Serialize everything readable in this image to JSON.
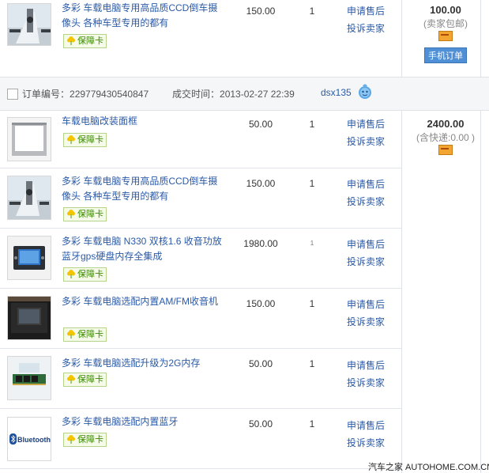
{
  "items_top": {
    "title": "多彩 车载电脑专用高品质CCD倒车摄像头 各种车型专用的都有",
    "price": "150.00",
    "qty": "1",
    "badge": "保障卡",
    "actions": [
      "申请售后",
      "投诉卖家"
    ]
  },
  "summary_top": {
    "total": "100.00",
    "shipping": "(卖家包邮)",
    "mobile_order": "手机订单"
  },
  "order": {
    "number_label": "订单编号：",
    "number": "229779430540847",
    "time_label": "成交时间：",
    "time": "2013-02-27 22:39",
    "seller": "dsx135"
  },
  "items": [
    {
      "title": "车载电脑改装面框",
      "price": "50.00",
      "qty": "1",
      "badge": "保障卡",
      "actions": [
        "申请售后",
        "投诉卖家"
      ]
    },
    {
      "title": "多彩 车载电脑专用高品质CCD倒车摄像头 各种车型专用的都有",
      "price": "150.00",
      "qty": "1",
      "badge": "保障卡",
      "actions": [
        "申请售后",
        "投诉卖家"
      ]
    },
    {
      "title": "多彩 车载电脑 N330 双核1.6 收音功放蓝牙gps硬盘内存全集成",
      "price": "1980.00",
      "qty": "1",
      "badge": "保障卡",
      "actions": [
        "申请售后",
        "投诉卖家"
      ]
    },
    {
      "title": "多彩 车载电脑选配内置AM/FM收音机",
      "price": "150.00",
      "qty": "1",
      "badge": "保障卡",
      "actions": [
        "申请售后",
        "投诉卖家"
      ]
    },
    {
      "title": "多彩 车载电脑选配升级为2G内存",
      "price": "50.00",
      "qty": "1",
      "badge": "保障卡",
      "actions": [
        "申请售后",
        "投诉卖家"
      ]
    },
    {
      "title": "多彩 车载电脑选配内置蓝牙",
      "price": "50.00",
      "qty": "1",
      "badge": "保障卡",
      "actions": [
        "申请售后",
        "投诉卖家"
      ]
    }
  ],
  "summary": {
    "total": "2400.00",
    "shipping": "(含快递:0.00 )"
  },
  "thumb_text": {
    "bluetooth": "Bluetooth"
  },
  "watermark": "汽车之家 AUTOHOME.COM.CN"
}
